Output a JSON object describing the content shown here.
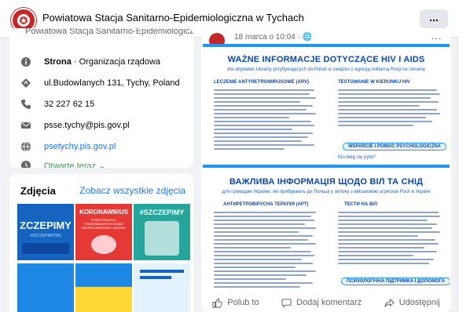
{
  "header": {
    "page_name": "Powiatowa Stacja Sanitarno-Epidemiologiczna w Tychach",
    "more_label": "..."
  },
  "intro": {
    "cut_text": "Powiatowa Stacja Sanitarno-Epidemiologiczna",
    "category_bold": "Strona",
    "category_rest": " · Organizacja rządowa",
    "address": "ul.Budowlanych 131, Tychy, Poland",
    "phone": "32 227 62 15",
    "email": "psse.tychy@pis.gov.pl",
    "website": "psetychy.pis.gov.pl",
    "hours": "Otwarte teraz",
    "hours_chevron": "⌄"
  },
  "photos": {
    "title": "Zdjęcia",
    "see_all": "Zobacz wszystkie zdjęcia",
    "thumbs": [
      {
        "caption": "ZCZEPIMY",
        "sub": "#SZCZEPIMYSIĘ"
      },
      {
        "caption": "KORONAWIRUS",
        "sub": "PRZESTRZEGAJ PODSTAWOWYCH ZASAD BEZPIECZEŃSTWA I HIGIENY"
      },
      {
        "caption": "#SZCZEPIMY",
        "sub": ""
      }
    ]
  },
  "post": {
    "date": "18 marca o 10:04 · 🌐",
    "dots": "···",
    "poster": {
      "title_pl": "WAŻNE INFORMACJE DOTYCZĄCE HIV I AIDS",
      "sub_pl": "dla obywateli Ukrainy przybywających do Polski w związku z agresją militarną Rosji na Ukrainę",
      "sec1_pl": "LECZENIE ANTYRETROWIRUSOWE (ARV)",
      "sec2_pl": "TESTOWANIE W KIERUNKU HIV",
      "pill_pl": "WSPARCIE I POMOC PSYCHOLOGICZNA",
      "small_pl": "Kto bieg się pyta?",
      "title_ua": "ВАЖЛИВА ІНФОРМАЦІЯ ЩОДО ВІЛ ТА СНІД",
      "sub_ua": "для громадян України, які прибувають до Польщі у зв'язку з військовою агресією Росії в Україні",
      "sec1_ua": "АНТИРЕТРОВІРУСНА ТЕРАПІЯ (АРТ)",
      "sec2_ua": "ТЕСТИ НА ВІЛ",
      "pill_ua": "ПСИХОЛОГІЧНА ПІДТРИМКА І ДОПОМОГА"
    },
    "actions": {
      "like": "Polub to",
      "comment": "Dodaj komentarz",
      "share": "Udostępnij"
    }
  },
  "colors": {
    "brand_blue": "#1877f2",
    "open_green": "#31a24c",
    "poster_blue": "#0d47a1"
  }
}
